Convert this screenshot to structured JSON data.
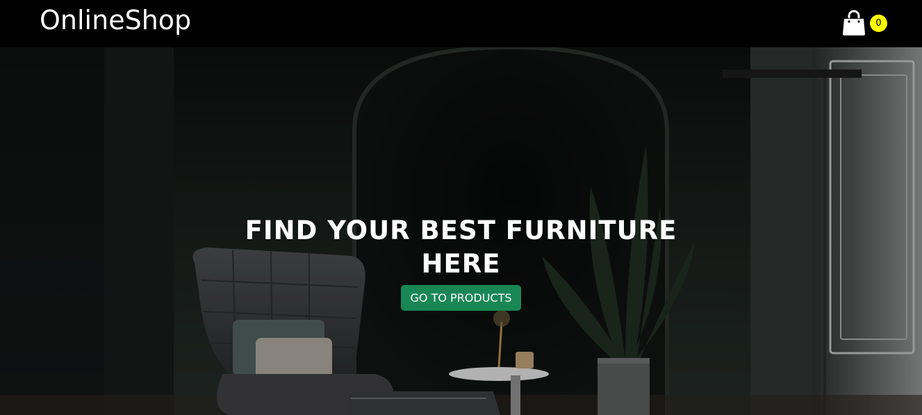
{
  "navbar": {
    "brand": "OnlineShop",
    "cart_count": "0",
    "cart_icon": "shopping-bag-icon"
  },
  "hero": {
    "title": "FIND YOUR BEST FURNITURE HERE",
    "cta_label": "GO TO PRODUCTS"
  },
  "colors": {
    "navbar_bg": "#000000",
    "badge_bg": "#ffff00",
    "cta_bg": "#198754",
    "text": "#ffffff"
  }
}
